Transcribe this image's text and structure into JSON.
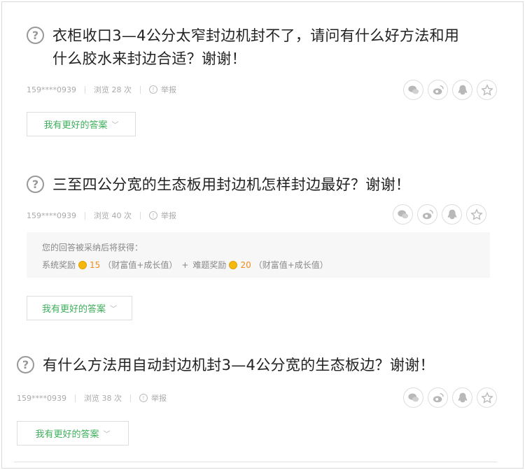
{
  "questions": [
    {
      "title_line1": "衣柜收口3—4公分太窄封边机封不了，请问有什么好方法和用",
      "title_line2": "什么胶水来封边合适？谢谢！",
      "user": "159****0939",
      "views": "浏览 28 次",
      "report": "举报",
      "answer_button": "我有更好的答案"
    },
    {
      "title_line1": "三至四公分宽的生态板用封边机怎样封边最好？谢谢！",
      "user": "159****0939",
      "views": "浏览 40 次",
      "report": "举报",
      "reward_heading": "您的回答被采纳后将获得：",
      "reward_system_label": "系统奖励",
      "reward_system_value": "15",
      "reward_system_note": "（财富值+成长值）",
      "reward_plus": "+",
      "reward_puzzle_label": "难题奖励",
      "reward_puzzle_value": "20",
      "reward_puzzle_note": "（财富值+成长值）",
      "answer_button": "我有更好的答案"
    },
    {
      "title_line1": "有什么方法用自动封边机封3—4公分宽的生态板边？谢谢！",
      "user": "159****0939",
      "views": "浏览 38 次",
      "report": "举报",
      "answer_button": "我有更好的答案"
    }
  ],
  "icons": {
    "question": "?",
    "info": "!",
    "chevron": "﹀"
  },
  "share_icons": [
    "wechat-icon",
    "weibo-icon",
    "qq-icon",
    "star-icon"
  ],
  "colors": {
    "accent_green": "#3eaf5c",
    "reward_orange": "#f28c1a",
    "coin_gold": "#f5b80f"
  }
}
